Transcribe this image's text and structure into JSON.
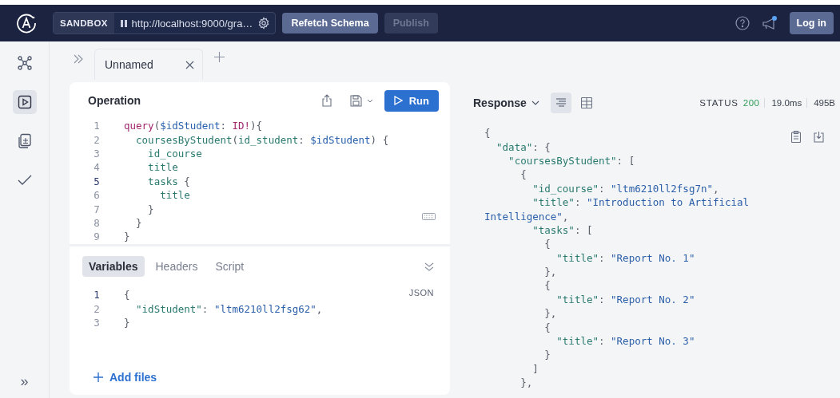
{
  "topbar": {
    "sandbox_label": "SANDBOX",
    "url": "http://localhost:9000/gra…",
    "buttons": [
      {
        "label": "Refetch Schema",
        "disabled": false
      },
      {
        "label": "Publish",
        "disabled": true
      }
    ],
    "login": "Log in"
  },
  "sidebar": {
    "items": [
      {
        "kind": "schema",
        "selected": false
      },
      {
        "kind": "explorer",
        "selected": true
      },
      {
        "kind": "collections",
        "selected": false
      },
      {
        "kind": "checks",
        "selected": false
      }
    ],
    "expand": "»"
  },
  "tabs": [
    {
      "label": "Unnamed",
      "selected": true
    }
  ],
  "operation": {
    "title": "Operation",
    "run": "Run",
    "lines": [
      {
        "number": "1",
        "active": false,
        "parts": [
          {
            "kind": "keyword",
            "text": "query"
          },
          {
            "kind": "punct",
            "text": "("
          },
          {
            "kind": "variable",
            "text": "$idStudent"
          },
          {
            "kind": "punct",
            "text": ": "
          },
          {
            "kind": "type",
            "text": "ID!"
          },
          {
            "kind": "punct",
            "text": "){"
          }
        ]
      },
      {
        "number": "2",
        "active": false,
        "parts": [
          {
            "kind": "field",
            "text": "  coursesByStudent"
          },
          {
            "kind": "punct",
            "text": "("
          },
          {
            "kind": "field",
            "text": "id_student"
          },
          {
            "kind": "punct",
            "text": ": "
          },
          {
            "kind": "variable",
            "text": "$idStudent"
          },
          {
            "kind": "punct",
            "text": ") {"
          }
        ]
      },
      {
        "number": "3",
        "active": false,
        "parts": [
          {
            "kind": "field",
            "text": "    id_course"
          }
        ]
      },
      {
        "number": "4",
        "active": false,
        "parts": [
          {
            "kind": "field",
            "text": "    title"
          }
        ]
      },
      {
        "number": "5",
        "active": true,
        "parts": [
          {
            "kind": "field",
            "text": "    tasks"
          },
          {
            "kind": "punct",
            "text": " {"
          }
        ]
      },
      {
        "number": "6",
        "active": false,
        "parts": [
          {
            "kind": "field",
            "text": "      title"
          }
        ]
      },
      {
        "number": "7",
        "active": false,
        "parts": [
          {
            "kind": "punct",
            "text": "    }"
          }
        ]
      },
      {
        "number": "8",
        "active": false,
        "parts": [
          {
            "kind": "punct",
            "text": "  }"
          }
        ]
      },
      {
        "number": "9",
        "active": false,
        "parts": [
          {
            "kind": "punct",
            "text": "}"
          }
        ]
      }
    ]
  },
  "variables": {
    "tabs": [
      {
        "label": "Variables",
        "selected": true
      },
      {
        "label": "Headers",
        "selected": false
      },
      {
        "label": "Script",
        "selected": false
      }
    ],
    "language": "JSON",
    "lines": [
      {
        "number": "1",
        "active": true,
        "parts": [
          {
            "kind": "punct",
            "text": "{"
          }
        ]
      },
      {
        "number": "2",
        "active": false,
        "parts": [
          {
            "kind": "key",
            "text": "  \"idStudent\""
          },
          {
            "kind": "punct",
            "text": ": "
          },
          {
            "kind": "string",
            "text": "\"ltm6210ll2fsg62\""
          },
          {
            "kind": "punct",
            "text": ","
          }
        ]
      },
      {
        "number": "3",
        "active": false,
        "parts": [
          {
            "kind": "punct",
            "text": "}"
          }
        ]
      }
    ],
    "add_files": "Add files"
  },
  "response": {
    "title": "Response",
    "views": [
      {
        "kind": "text",
        "selected": true
      },
      {
        "kind": "table",
        "selected": false
      }
    ],
    "status_label": "STATUS",
    "status_code": "200",
    "time": "19.0ms",
    "size": "495B",
    "lines": [
      [
        {
          "kind": "punct",
          "text": "{"
        }
      ],
      [
        {
          "kind": "key",
          "text": "  \"data\""
        },
        {
          "kind": "punct",
          "text": ": {"
        }
      ],
      [
        {
          "kind": "key",
          "text": "    \"coursesByStudent\""
        },
        {
          "kind": "punct",
          "text": ": ["
        }
      ],
      [
        {
          "kind": "punct",
          "text": "      {"
        }
      ],
      [
        {
          "kind": "key",
          "text": "        \"id_course\""
        },
        {
          "kind": "punct",
          "text": ": "
        },
        {
          "kind": "string",
          "text": "\"ltm6210ll2fsg7n\""
        },
        {
          "kind": "punct",
          "text": ","
        }
      ],
      [
        {
          "kind": "key",
          "text": "        \"title\""
        },
        {
          "kind": "punct",
          "text": ": "
        },
        {
          "kind": "string",
          "text": "\"Introduction to Artificial"
        }
      ],
      [
        {
          "kind": "string",
          "text": "Intelligence\""
        },
        {
          "kind": "punct",
          "text": ","
        }
      ],
      [
        {
          "kind": "key",
          "text": "        \"tasks\""
        },
        {
          "kind": "punct",
          "text": ": ["
        }
      ],
      [
        {
          "kind": "punct",
          "text": "          {"
        }
      ],
      [
        {
          "kind": "key",
          "text": "            \"title\""
        },
        {
          "kind": "punct",
          "text": ": "
        },
        {
          "kind": "string",
          "text": "\"Report No. 1\""
        }
      ],
      [
        {
          "kind": "punct",
          "text": "          },"
        }
      ],
      [
        {
          "kind": "punct",
          "text": "          {"
        }
      ],
      [
        {
          "kind": "key",
          "text": "            \"title\""
        },
        {
          "kind": "punct",
          "text": ": "
        },
        {
          "kind": "string",
          "text": "\"Report No. 2\""
        }
      ],
      [
        {
          "kind": "punct",
          "text": "          },"
        }
      ],
      [
        {
          "kind": "punct",
          "text": "          {"
        }
      ],
      [
        {
          "kind": "key",
          "text": "            \"title\""
        },
        {
          "kind": "punct",
          "text": ": "
        },
        {
          "kind": "string",
          "text": "\"Report No. 3\""
        }
      ],
      [
        {
          "kind": "punct",
          "text": "          }"
        }
      ],
      [
        {
          "kind": "punct",
          "text": "        ]"
        }
      ],
      [
        {
          "kind": "punct",
          "text": "      },"
        }
      ]
    ]
  }
}
